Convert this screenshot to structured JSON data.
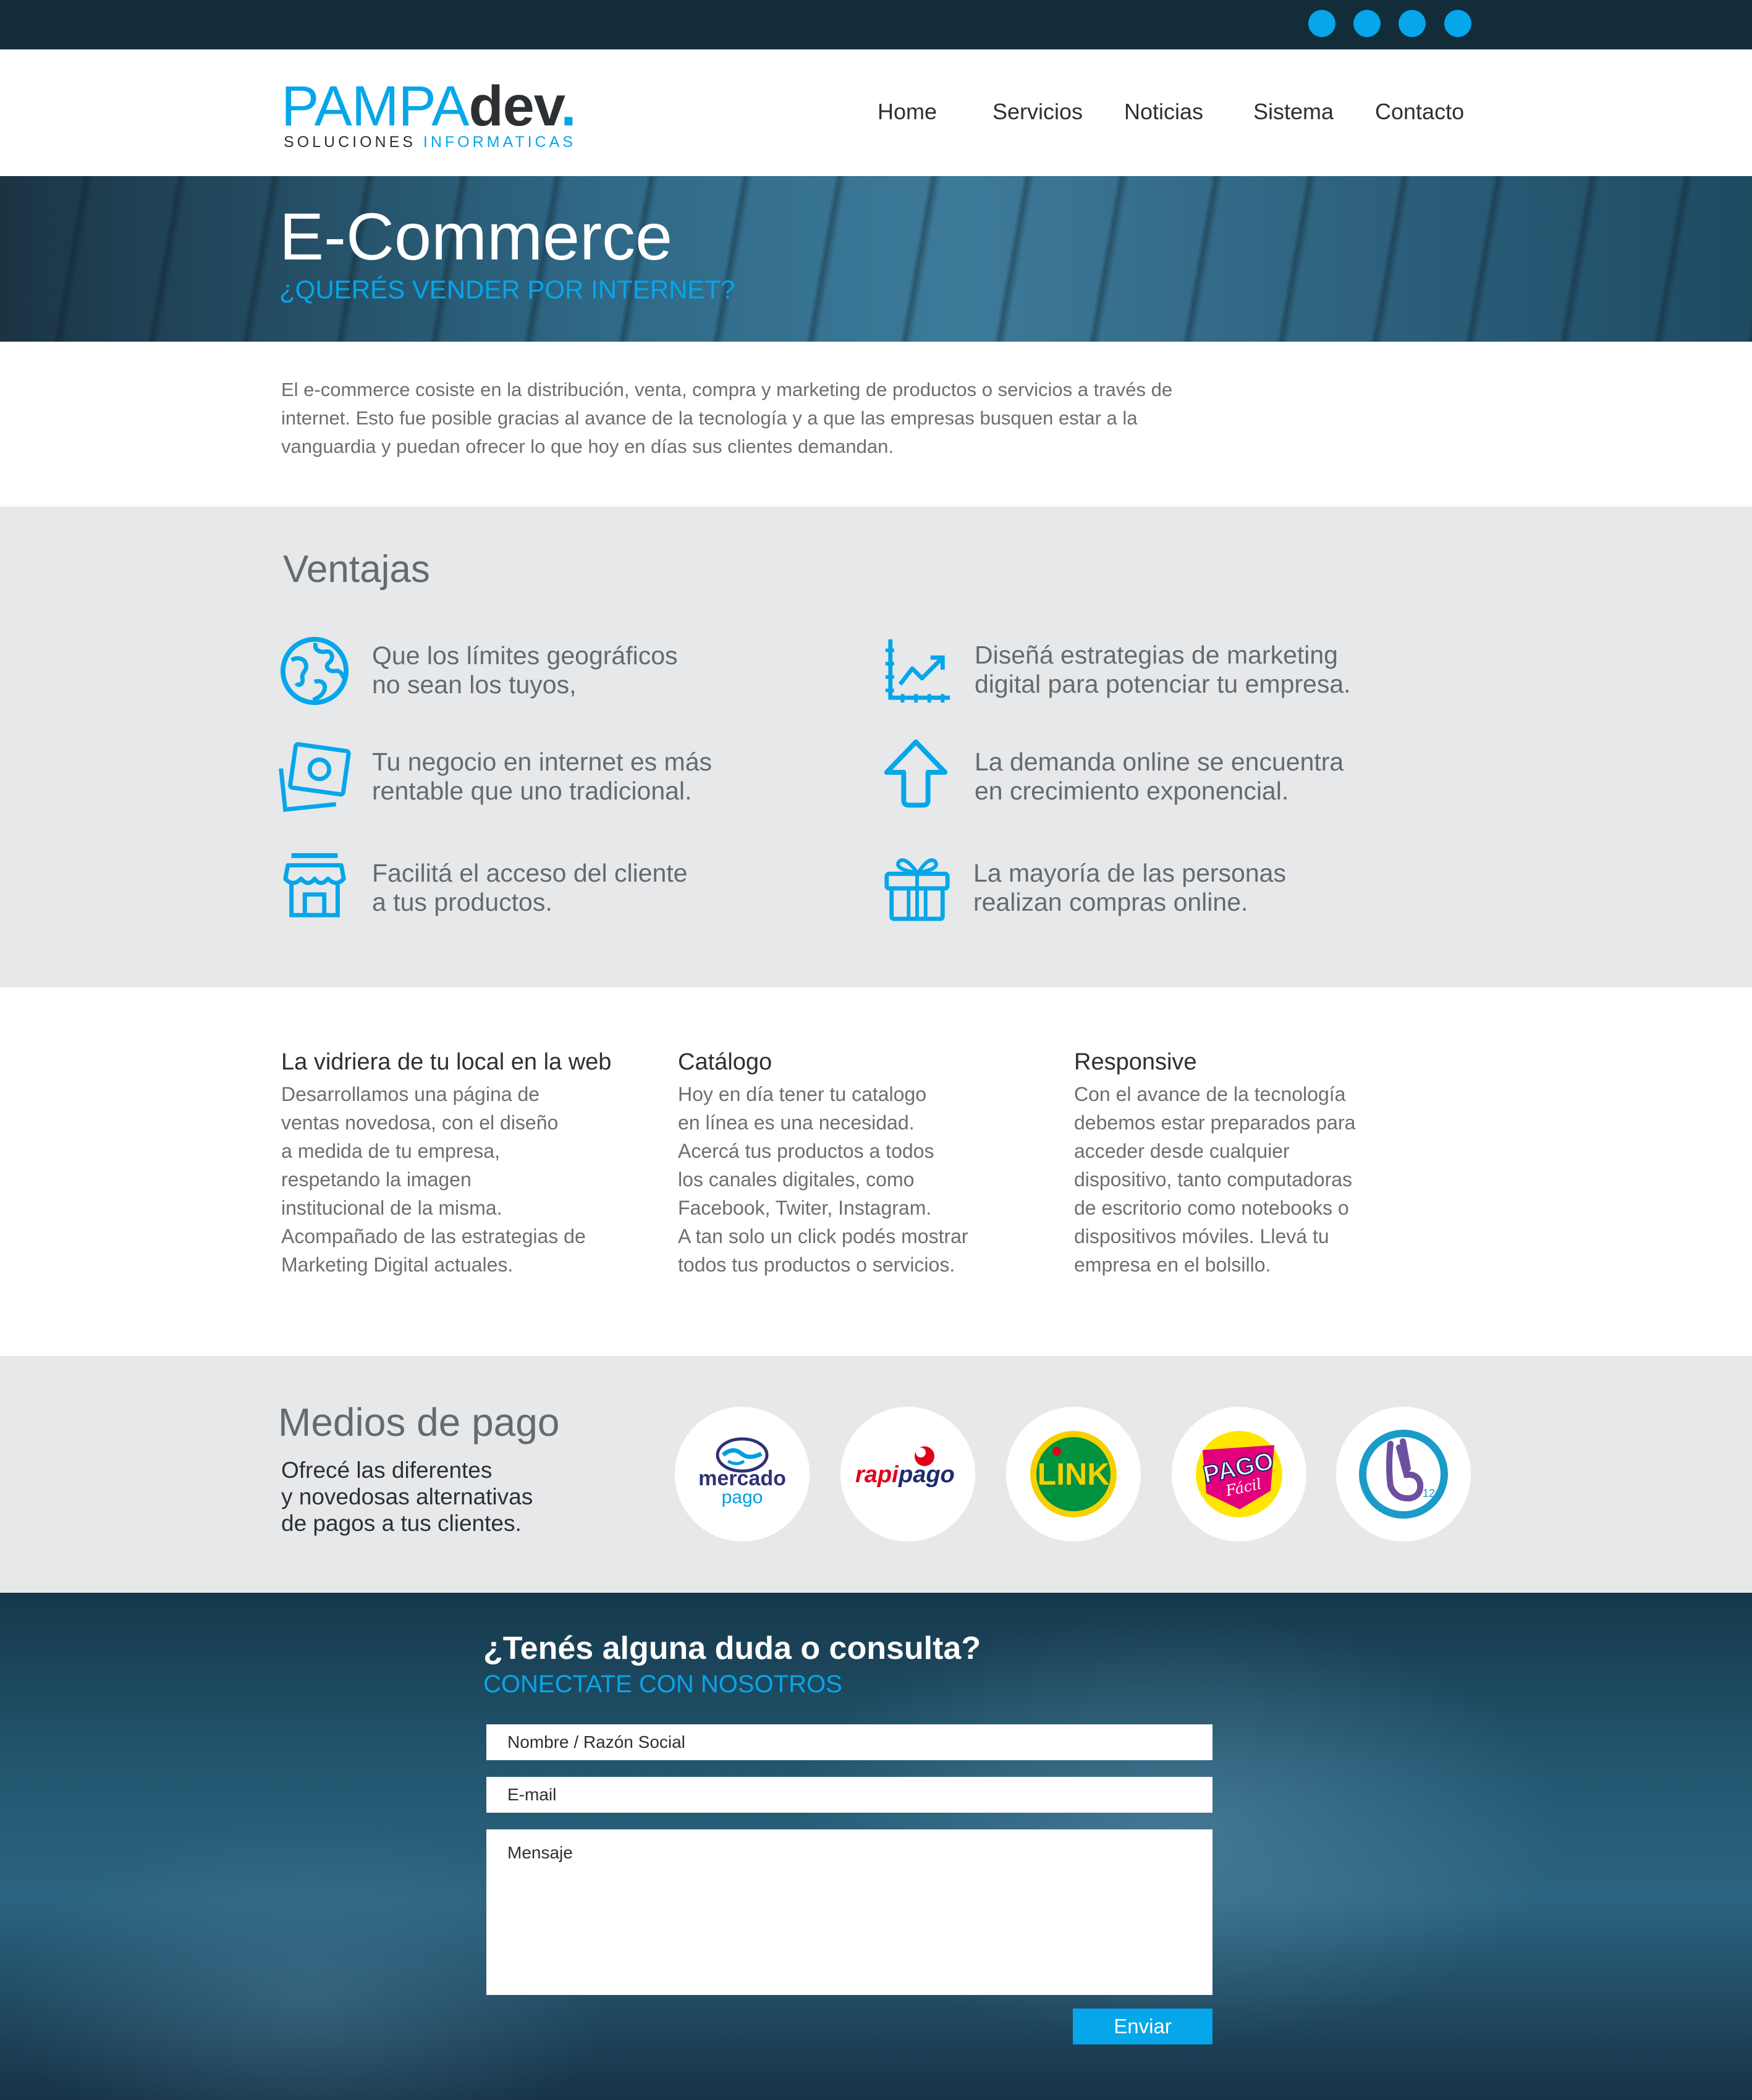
{
  "colors": {
    "accent": "#06a6ea",
    "topbar": "#132c3a",
    "dark_text": "#2d3033",
    "grey_text": "#666a6d",
    "section_bg": "#e6e8ea"
  },
  "topbar": {
    "social_icons": [
      "social-icon-1",
      "social-icon-2",
      "social-icon-3",
      "social-icon-4"
    ]
  },
  "logo": {
    "pampa": "PAMPA",
    "dev": "dev",
    "dot": ".",
    "sub1": "SOLUCIONES",
    "sub2": "INFORMATICAS"
  },
  "nav": {
    "items": [
      "Home",
      "Servicios",
      "Noticias",
      "Sistema",
      "Contacto"
    ]
  },
  "hero": {
    "title": "E-Commerce",
    "subtitle": "¿QUERÉS VENDER POR INTERNET?"
  },
  "intro": {
    "text": "El e-commerce cosiste en la distribución, venta, compra y marketing de productos o servicios a través de internet. Esto fue posible gracias al avance de la tecnología y a que las empresas busquen estar a la vanguardia y puedan ofrecer lo que hoy en días sus clientes demandan."
  },
  "ventajas": {
    "title": "Ventajas",
    "items": [
      {
        "icon": "globe-icon",
        "line1": "Que los límites geográficos",
        "line2": "no sean los tuyos,"
      },
      {
        "icon": "chart-icon",
        "line1": "Diseñá estrategias de marketing",
        "line2": "digital para potenciar tu empresa."
      },
      {
        "icon": "money-icon",
        "line1": "Tu negocio en internet es más",
        "line2": "rentable que uno tradicional."
      },
      {
        "icon": "arrow-up-icon",
        "line1": "La demanda online se encuentra",
        "line2": "en crecimiento exponencial."
      },
      {
        "icon": "store-icon",
        "line1": "Facilitá el acceso del cliente",
        "line2": "a tus productos."
      },
      {
        "icon": "gift-icon",
        "line1": "La mayoría de las personas",
        "line2": "realizan compras online."
      }
    ]
  },
  "features": [
    {
      "title": "La vidriera de tu local en la web",
      "body": "Desarrollamos una página de\nventas novedosa, con el diseño\na medida de tu empresa,\nrespetando la imagen\ninstitucional de la misma.\nAcompañado de las estrategias de\nMarketing Digital actuales."
    },
    {
      "title": "Catálogo",
      "body": "Hoy en día tener tu catalogo\nen línea es una necesidad.\nAcercá tus productos a todos\nlos canales digitales, como\nFacebook, Twiter, Instagram.\nA tan solo un click podés mostrar\ntodos tus productos o servicios."
    },
    {
      "title": "Responsive",
      "body": "Con el avance de la tecnología\ndebemos estar preparados para\nacceder desde cualquier\ndispositivo, tanto computadoras\nde escritorio como notebooks o\ndispositivos móviles. Llevá tu\nempresa en el bolsillo."
    }
  ],
  "medios": {
    "title": "Medios de pago",
    "text": "Ofrecé las diferentes\ny novedosas alternativas\nde pagos a tus clientes.",
    "logos": {
      "mercadopago": {
        "line1": "mercado",
        "line2": "pago"
      },
      "rapipago": {
        "part1": "rapi",
        "part2": "pago"
      },
      "link": {
        "text": "LINK"
      },
      "pagofacil": {
        "line1": "PAGO",
        "line2": "Fácil"
      },
      "provincia": {
        "text": "12"
      }
    }
  },
  "contact": {
    "title": "¿Tenés alguna duda o consulta?",
    "subtitle": "CONECTATE CON NOSOTROS",
    "name_placeholder": "Nombre / Razón Social",
    "email_placeholder": "E-mail",
    "message_placeholder": "Mensaje",
    "send_label": "Enviar"
  }
}
